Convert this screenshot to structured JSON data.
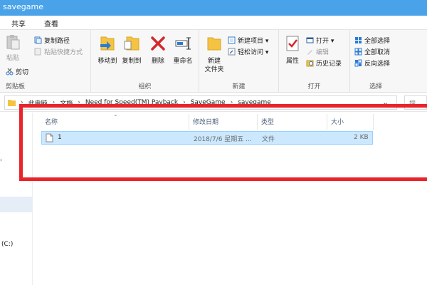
{
  "window": {
    "title": "savegame"
  },
  "tabs": [
    "共享",
    "查看"
  ],
  "ribbon": {
    "clipboard": {
      "label": "剪贴板",
      "paste": "粘贴",
      "copy_path": "复制路径",
      "paste_shortcut": "粘贴快捷方式",
      "cut": "剪切"
    },
    "organize": {
      "label": "组织",
      "move_to": "移动到",
      "copy_to": "复制到",
      "delete": "删除",
      "rename": "重命名"
    },
    "new": {
      "label": "新建",
      "new_folder_1": "新建",
      "new_folder_2": "文件夹",
      "new_item": "新建项目 ▾",
      "easy_access": "轻松访问 ▾"
    },
    "open": {
      "label": "打开",
      "properties": "属性",
      "open": "打开 ▾",
      "edit": "编辑",
      "history": "历史记录"
    },
    "select": {
      "label": "选择",
      "select_all": "全部选择",
      "select_none": "全部取消",
      "invert": "反向选择"
    }
  },
  "address": {
    "crumbs": [
      "此电脑",
      "文档",
      "Need for Speed(TM) Payback",
      "SaveGame",
      "savegame"
    ],
    "search_placeholder": "搜"
  },
  "sidebar": {
    "drive_label": "(C:)"
  },
  "columns": {
    "name": "名称",
    "modified": "修改日期",
    "type": "类型",
    "size": "大小"
  },
  "files": [
    {
      "name": "1",
      "modified": "2018/7/6 星期五 ...",
      "type": "文件",
      "size": "2 KB"
    }
  ],
  "colors": {
    "titlebar": "#4aa3e8",
    "selection": "#cce8ff",
    "highlight_box": "#e8242b",
    "delete_icon": "#d6262b"
  }
}
